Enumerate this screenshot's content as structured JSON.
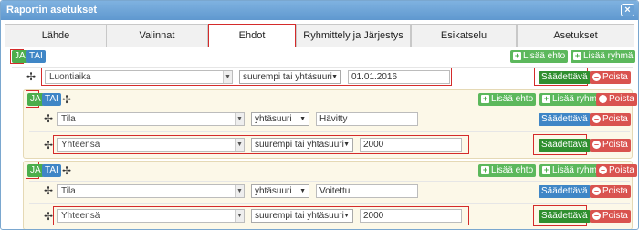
{
  "window": {
    "title": "Raportin asetukset",
    "close": "×"
  },
  "tabs": [
    {
      "label": "Lähde"
    },
    {
      "label": "Valinnat"
    },
    {
      "label": "Ehdot"
    },
    {
      "label": "Ryhmittely ja Järjestys"
    },
    {
      "label": "Esikatselu"
    },
    {
      "label": "Asetukset"
    }
  ],
  "labels": {
    "and": "JA",
    "or": "TAI",
    "add_condition": "Lisää ehto",
    "add_group": "Lisää ryhmä",
    "remove": "Poista",
    "adjustable": "Säädettävä"
  },
  "root_row": {
    "field": "Luontiaika",
    "operator": "suurempi tai yhtäsuuri",
    "value": "01.01.2016"
  },
  "group1": {
    "rows": [
      {
        "field": "Tila",
        "operator": "yhtäsuuri",
        "value": "Hävitty"
      },
      {
        "field": "Yhteensä",
        "operator": "suurempi tai yhtäsuuri",
        "value": "2000"
      }
    ]
  },
  "group2": {
    "rows": [
      {
        "field": "Tila",
        "operator": "yhtäsuuri",
        "value": "Voitettu"
      },
      {
        "field": "Yhteensä",
        "operator": "suurempi tai yhtäsuuri",
        "value": "2000"
      }
    ]
  },
  "icons": {
    "move": "move-icon",
    "caret": "caret-down-icon"
  },
  "colors": {
    "and": "#4cae4c",
    "or": "#3f86c6",
    "danger": "#d9534f",
    "highlight": "#d42b2b"
  }
}
